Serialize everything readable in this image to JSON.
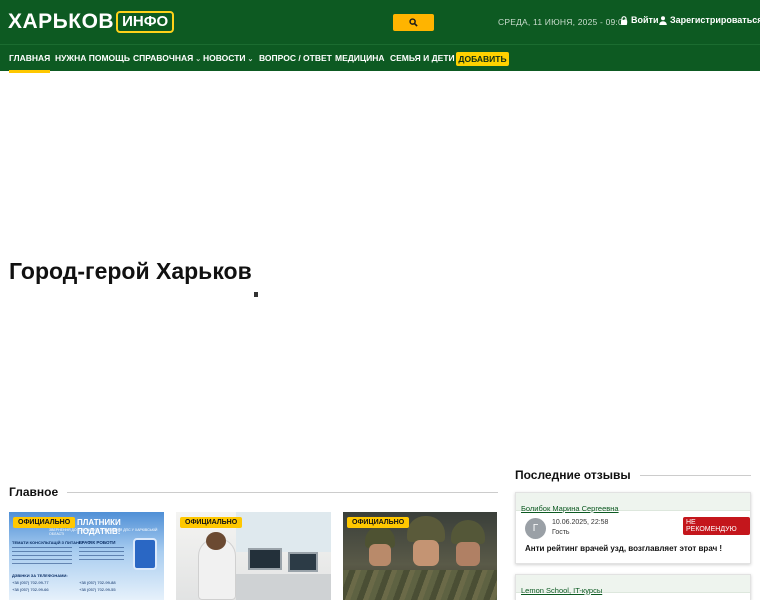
{
  "header": {
    "logo_main": "ХАРЬКОВ",
    "logo_box": "ИНФО",
    "date": "СРЕДА, 11 ИЮНЯ, 2025 - 09:00",
    "login": "Войти",
    "register": "Зарегистрироваться"
  },
  "nav": {
    "items": [
      {
        "label": "ГЛАВНАЯ"
      },
      {
        "label": "НУЖНА ПОМОЩЬ"
      },
      {
        "label": "СПРАВОЧНАЯ",
        "caret": "⌄"
      },
      {
        "label": "НОВОСТИ",
        "caret": "⌄"
      },
      {
        "label": "ВОПРОС / ОТВЕТ"
      },
      {
        "label": "МЕДИЦИНА"
      },
      {
        "label": "СЕМЬЯ И ДЕТИ"
      }
    ],
    "add_label": "ДОБАВИТЬ"
  },
  "hero": {
    "title": "Город-герой Харьков"
  },
  "main_section": {
    "title": "Главное",
    "cards": [
      {
        "badge": "ОФИЦИАЛЬНО",
        "poster_headline": "ПЛАТНИКИ ПОДАТКІВ!",
        "poster_sub": "ЗВЕРНЕННЯ ДО ГОЛОВНОГО УПРАВЛІННЯ ДПС У ХАРКІВСЬКІЙ ОБЛАСТІ",
        "poster_left_1": "ТЕМАТИ КОНСУЛЬТАЦІЙ З ПИТАНЬ:",
        "poster_right_1": "ГРАФІК РОБОТИ",
        "poster_left_2": "ДЗВІНКИ ЗА ТЕЛЕФОНАМИ:",
        "phones": [
          "+38 (057) 702-99-77",
          "+38 (057) 702-99-88",
          "+38 (057) 702-99-66",
          "+38 (057) 702-99-55"
        ]
      },
      {
        "badge": "ОФИЦИАЛЬНО"
      },
      {
        "badge": "ОФИЦИАЛЬНО"
      }
    ]
  },
  "reviews": {
    "title": "Последние отзывы",
    "items": [
      {
        "doctor": "Болибок Марина Сергеевна",
        "avatar_letter": "Г",
        "date": "10.06.2025, 22:58",
        "user": "Гость",
        "flag": "НЕ РЕКОМЕНДУЮ",
        "text": "Анти рейтинг врачей узд, возглавляет этот врач !"
      },
      {
        "doctor": "Lemon School, IT-курсы"
      }
    ]
  },
  "colors": {
    "header_green": "#0d5a22",
    "accent_yellow": "#ffc800",
    "alert_red": "#c4161c"
  }
}
